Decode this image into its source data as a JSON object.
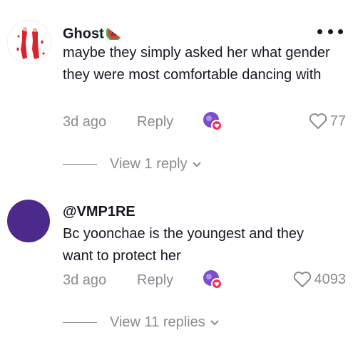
{
  "comments": [
    {
      "username": "Ghost",
      "username_emoji": "watermelon-icon",
      "text": "maybe they simply asked her what gender they were most comfortable dancing with",
      "time": "3d ago",
      "reply_label": "Reply",
      "likes": "77",
      "view_replies_label": "View 1 reply"
    },
    {
      "username": "@VMP1RE",
      "text": "Bc yoonchae is the youngest and they want to protect her",
      "time": "3d ago",
      "reply_label": "Reply",
      "likes": "4093",
      "view_replies_label": "View 11 replies",
      "avatar_color": "#4b2a8c"
    }
  ],
  "colors": {
    "text_primary": "#161823",
    "text_secondary": "#8a8b91",
    "creator_badge": "#fe2c55"
  }
}
